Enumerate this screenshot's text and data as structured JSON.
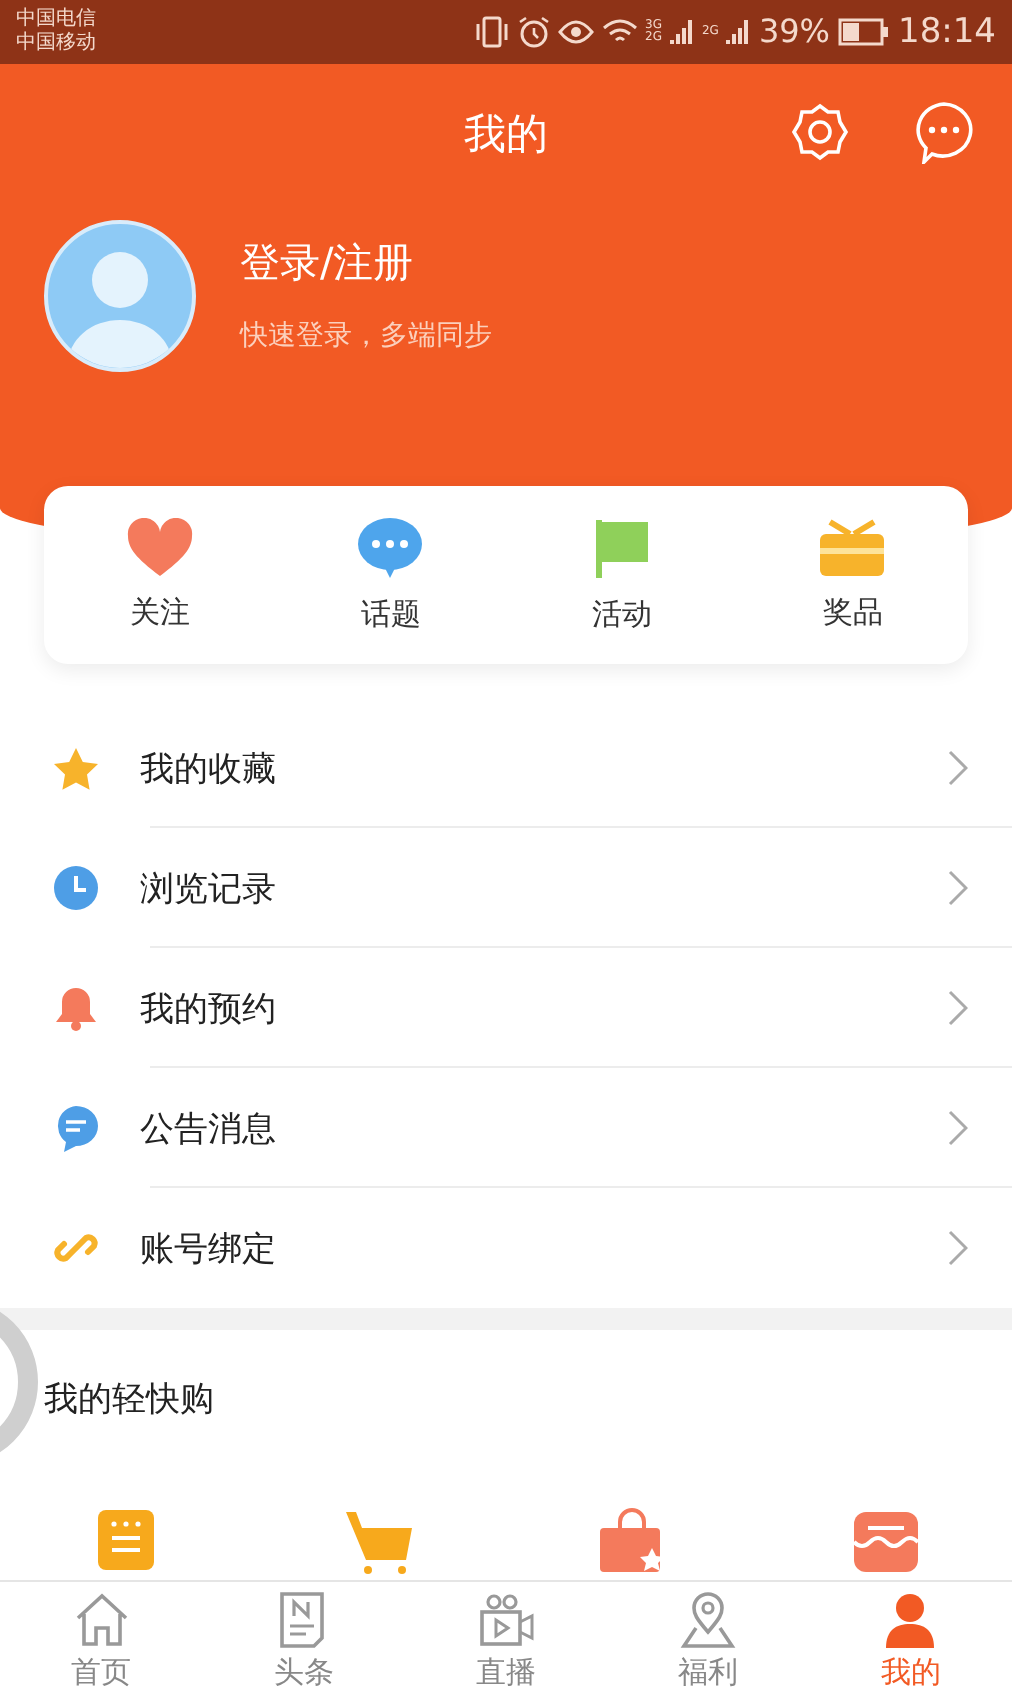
{
  "status_bar": {
    "carriers": [
      "中国电信",
      "中国移动"
    ],
    "network_labels": [
      {
        "top": "3G",
        "bottom": "2G"
      },
      {
        "top": "2G"
      }
    ],
    "battery_text": "39%",
    "time": "18:14"
  },
  "header": {
    "title": "我的"
  },
  "profile": {
    "name": "登录/注册",
    "subtitle": "快速登录，多端同步"
  },
  "quick_actions": [
    {
      "label": "关注",
      "kind": "heart"
    },
    {
      "label": "话题",
      "kind": "chat"
    },
    {
      "label": "活动",
      "kind": "flag"
    },
    {
      "label": "奖品",
      "kind": "gift"
    }
  ],
  "menu": [
    {
      "label": "我的收藏",
      "kind": "star"
    },
    {
      "label": "浏览记录",
      "kind": "clock"
    },
    {
      "label": "我的预约",
      "kind": "bell"
    },
    {
      "label": "公告消息",
      "kind": "message"
    },
    {
      "label": "账号绑定",
      "kind": "link"
    }
  ],
  "shop": {
    "title": "我的轻快购",
    "items": [
      {
        "kind": "list"
      },
      {
        "kind": "cart"
      },
      {
        "kind": "bag"
      },
      {
        "kind": "store"
      }
    ]
  },
  "loading": true,
  "tabs": [
    {
      "label": "首页",
      "kind": "home",
      "selected": false
    },
    {
      "label": "头条",
      "kind": "news",
      "selected": false
    },
    {
      "label": "直播",
      "kind": "video",
      "selected": false
    },
    {
      "label": "福利",
      "kind": "location",
      "selected": false
    },
    {
      "label": "我的",
      "kind": "person",
      "selected": true
    }
  ]
}
